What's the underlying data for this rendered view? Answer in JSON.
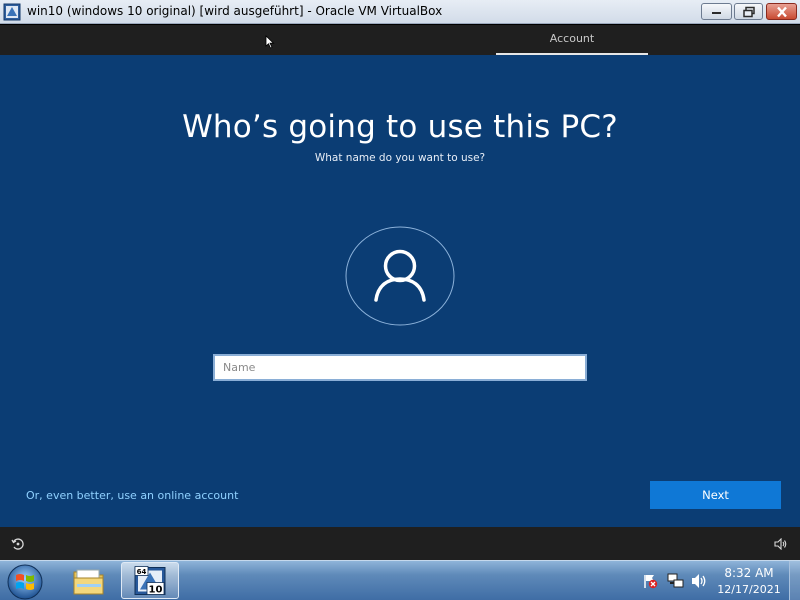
{
  "window": {
    "title": "win10 (windows 10 original) [wird ausgeführt] - Oracle VM VirtualBox",
    "app_icon": "virtualbox-icon",
    "controls": [
      "minimize-icon",
      "maximize-icon",
      "close-icon"
    ]
  },
  "oobe": {
    "top_tab": "Account",
    "heading": "Who’s going to use this PC?",
    "subheading": "What name do you want to use?",
    "avatar_icon": "user-icon",
    "name_input": {
      "value": "",
      "placeholder": "Name"
    },
    "online_account_link": "Or, even better, use an online account",
    "next_label": "Next",
    "bottom_icons": [
      "ease-of-access-icon",
      "volume-icon"
    ]
  },
  "taskbar": {
    "items": [
      "start-orb",
      "file-explorer-icon",
      "virtualbox-icon"
    ],
    "active_item": "virtualbox-icon",
    "virtualbox_badge": "64",
    "virtualbox_version": "10",
    "tray_icons": [
      "action-center-flag-icon",
      "network-icon",
      "volume-icon"
    ],
    "clock": {
      "time": "8:32 AM",
      "date": "12/17/2021"
    }
  }
}
